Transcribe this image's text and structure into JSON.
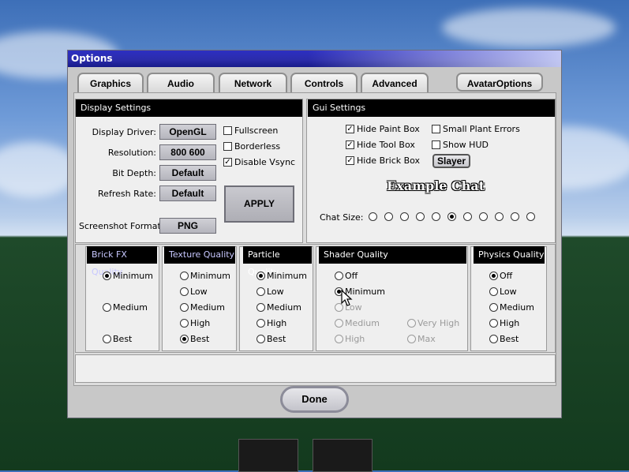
{
  "window": {
    "title": "Options"
  },
  "tabs": [
    "Graphics",
    "Audio",
    "Network",
    "Controls",
    "Advanced"
  ],
  "avatar_button": "AvatarOptions",
  "display_settings": {
    "title": "Display Settings",
    "display_driver_label": "Display Driver:",
    "display_driver_value": "OpenGL",
    "resolution_label": "Resolution:",
    "resolution_value": "800 600",
    "bit_depth_label": "Bit Depth:",
    "bit_depth_value": "Default",
    "refresh_rate_label": "Refresh Rate:",
    "refresh_rate_value": "Default",
    "screenshot_format_label": "Screenshot Format:",
    "screenshot_format_value": "PNG",
    "fullscreen": {
      "label": "Fullscreen",
      "checked": false
    },
    "borderless": {
      "label": "Borderless",
      "checked": false
    },
    "disable_vsync": {
      "label": "Disable Vsync",
      "checked": true
    },
    "apply_label": "APPLY"
  },
  "gui_settings": {
    "title": "Gui Settings",
    "hide_paint_box": {
      "label": "Hide Paint Box",
      "checked": true
    },
    "hide_tool_box": {
      "label": "Hide Tool Box",
      "checked": true
    },
    "hide_brick_box": {
      "label": "Hide Brick Box",
      "checked": true
    },
    "small_plant_errors": {
      "label": "Small Plant Errors",
      "checked": false
    },
    "show_hud": {
      "label": "Show HUD",
      "checked": false
    },
    "slayer_label": "Slayer",
    "example_chat": "Example Chat",
    "chat_size_label": "Chat Size:",
    "chat_size_count": 11,
    "chat_size_selected": 5
  },
  "brick_fx": {
    "title": "Brick FX Quality",
    "options": [
      "Minimum",
      "Medium",
      "Best"
    ],
    "selected": "Minimum"
  },
  "texture": {
    "title": "Texture Quality",
    "options": [
      "Minimum",
      "Low",
      "Medium",
      "High",
      "Best"
    ],
    "selected": "Best"
  },
  "particle": {
    "title": "Particle Quality",
    "options": [
      "Minimum",
      "Low",
      "Medium",
      "High",
      "Best"
    ],
    "selected": "Minimum"
  },
  "shader": {
    "title": "Shader Quality",
    "options": [
      "Off",
      "Minimum",
      "Low",
      "Medium",
      "High",
      "Very High",
      "Max"
    ],
    "selected": "Minimum",
    "disabled": [
      "Low",
      "Medium",
      "High",
      "Very High",
      "Max"
    ]
  },
  "physics": {
    "title": "Physics Quality",
    "options": [
      "Off",
      "Low",
      "Medium",
      "High",
      "Best"
    ],
    "selected": "Off"
  },
  "done_label": "Done"
}
